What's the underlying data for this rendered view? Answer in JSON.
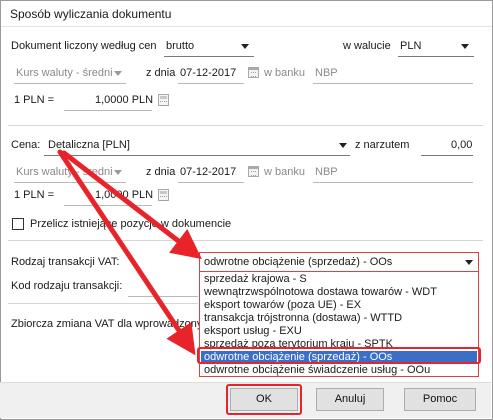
{
  "dialog": {
    "title": "Sposób wyliczania dokumentu"
  },
  "calc": {
    "label": "Dokument liczony według cen",
    "value": "brutto",
    "currency_label": "w walucie",
    "currency_value": "PLN"
  },
  "rate1": {
    "type_value": "Kurs waluty - średni",
    "date_label": "z dnia",
    "date_value": "07-12-2017",
    "bank_label": "w banku",
    "bank_value": "NBP",
    "pln_label": "1 PLN =",
    "pln_value": "1,0000 PLN"
  },
  "price": {
    "label": "Cena:",
    "value": "Detaliczna [PLN]",
    "markup_label": "z narzutem",
    "markup_value": "0,00"
  },
  "rate2": {
    "type_value": "Kurs waluty - średni",
    "date_label": "z dnia",
    "date_value": "07-12-2017",
    "bank_label": "w banku",
    "bank_value": "NBP",
    "pln_label": "1 PLN =",
    "pln_value": "1,0000 PLN"
  },
  "recalc": {
    "label": "Przelicz istniejące pozycje w dokumencie",
    "checked": false
  },
  "vat": {
    "type_label": "Rodzaj transakcji VAT:",
    "type_value": "odwrotne obciążenie (sprzedaż) - OOs",
    "code_label": "Kod rodzaju transakcji:",
    "bulk_label": "Zbiorcza zmiana VAT dla wprowadzonych",
    "options": [
      {
        "label": "sprzedaż krajowa - S"
      },
      {
        "label": "wewnątrzwspólnotowa dostawa towarów - WDT"
      },
      {
        "label": "eksport towarów (poza UE) - EX"
      },
      {
        "label": "transakcja trójstronna (dostawa) - WTTD"
      },
      {
        "label": "eksport usług - EXU"
      },
      {
        "label": "sprzedaż poza terytorium kraju - SPTK"
      },
      {
        "label": "odwrotne obciążenie (sprzedaż) - OOs"
      },
      {
        "label": "odwrotne obciążenie świadczenie usług - OOu"
      }
    ],
    "selected_index": 6
  },
  "buttons": {
    "ok": "OK",
    "cancel": "Anuluj",
    "help": "Pomoc"
  },
  "colors": {
    "highlight": "#e8242a",
    "selection": "#3a6ec7"
  }
}
